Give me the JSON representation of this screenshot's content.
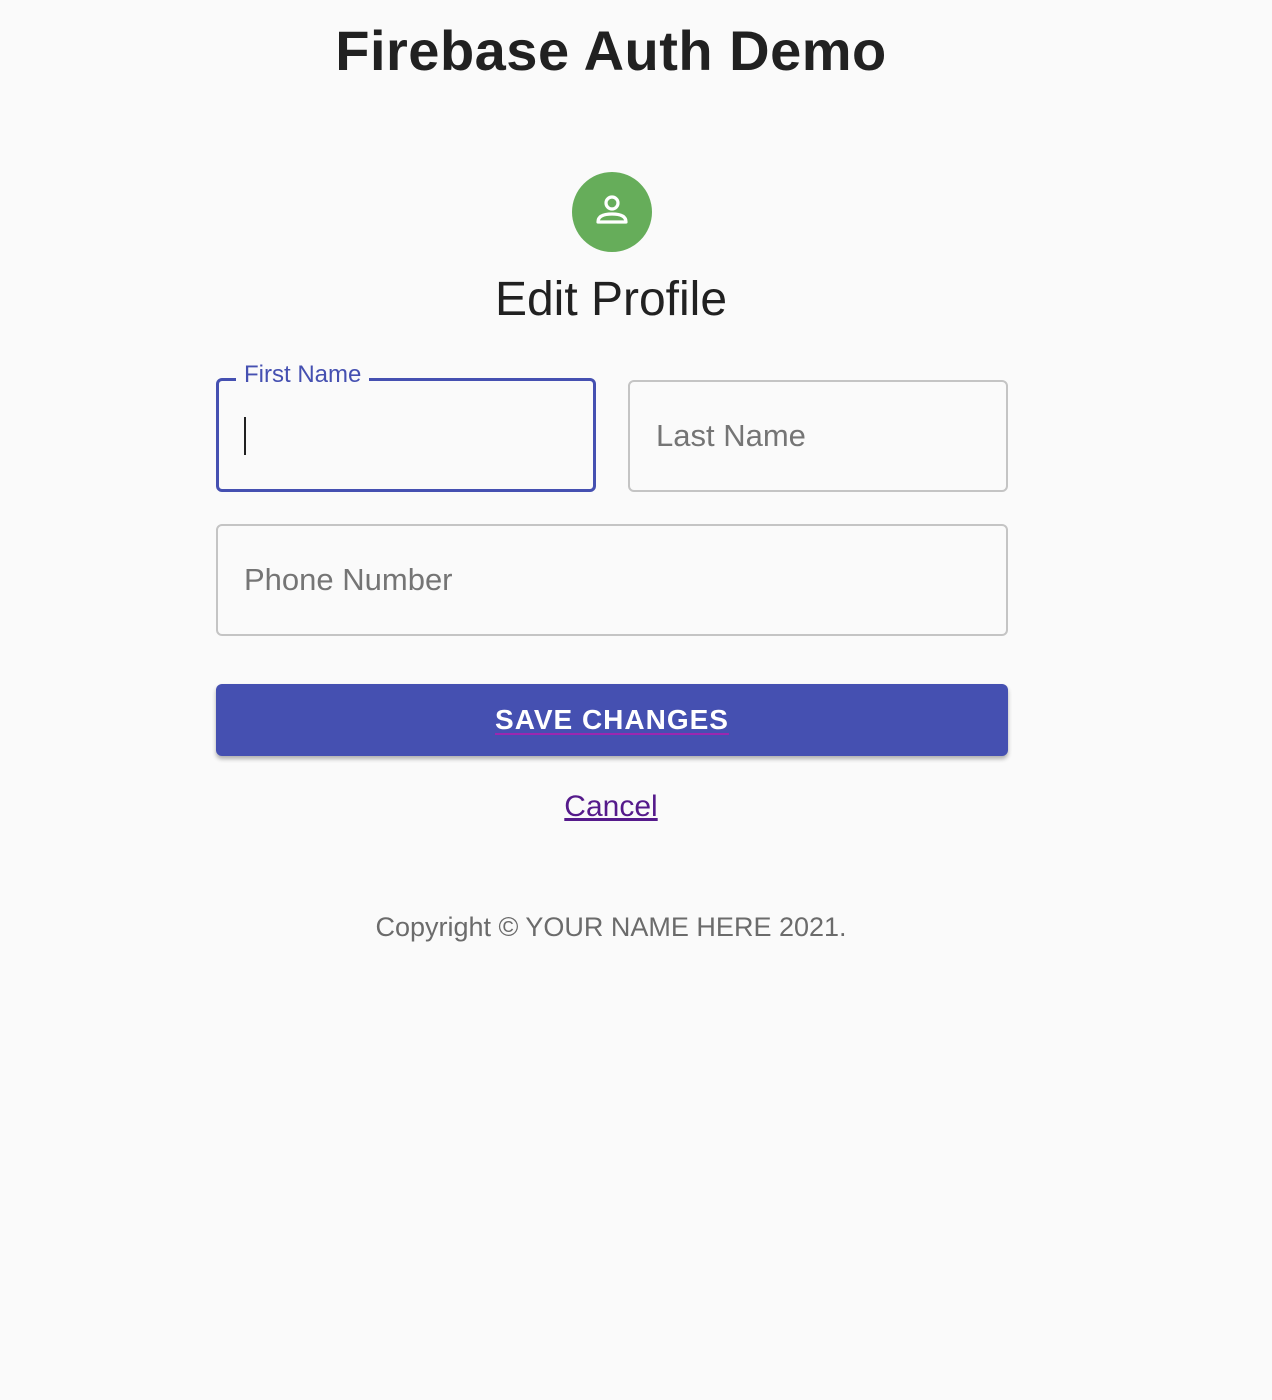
{
  "app": {
    "title": "Firebase Auth Demo"
  },
  "profile": {
    "heading": "Edit Profile",
    "avatar_icon": "person-outline-icon",
    "avatar_color": "#66ad5a"
  },
  "form": {
    "first_name": {
      "label": "First Name",
      "value": "",
      "placeholder": ""
    },
    "last_name": {
      "value": "",
      "placeholder": "Last Name"
    },
    "phone_number": {
      "value": "",
      "placeholder": "Phone Number"
    },
    "save_label": "SAVE CHANGES",
    "cancel_label": "Cancel"
  },
  "footer": {
    "copyright": "Copyright © YOUR NAME HERE 2021."
  },
  "colors": {
    "primary": "#4550b1",
    "link": "#551a8b",
    "background": "#fafafa"
  }
}
